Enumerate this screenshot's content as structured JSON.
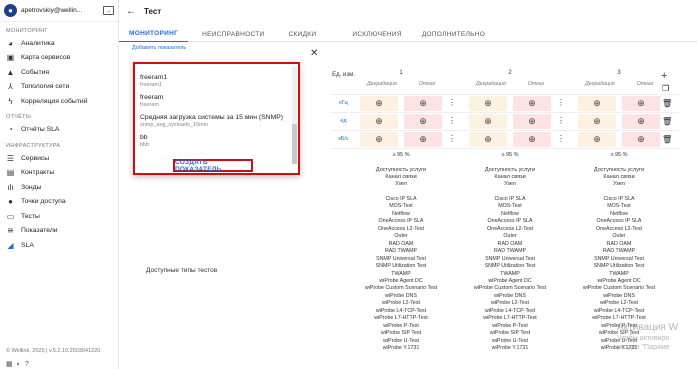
{
  "user": {
    "name": "apetrovskiy@wellin..."
  },
  "sidebar": {
    "sections": [
      {
        "title": "МОНИТОРИНГ",
        "items": [
          {
            "label": "Аналитика",
            "icon": "analytics-icon"
          },
          {
            "label": "Карта сервисов",
            "icon": "map-icon"
          },
          {
            "label": "События",
            "icon": "warning-icon"
          },
          {
            "label": "Топология сети",
            "icon": "topology-icon"
          },
          {
            "label": "Корреляция событий",
            "icon": "correlation-icon"
          }
        ]
      },
      {
        "title": "ОТЧЁТЫ",
        "items": [
          {
            "label": "Отчёты SLA",
            "icon": "report-icon"
          }
        ]
      },
      {
        "title": "ИНФРАСТРУКТУРА",
        "items": [
          {
            "label": "Сервисы",
            "icon": "list-icon"
          },
          {
            "label": "Контракты",
            "icon": "contract-icon"
          },
          {
            "label": "Зонды",
            "icon": "probe-icon"
          },
          {
            "label": "Точки доступа",
            "icon": "dot-icon"
          },
          {
            "label": "Тесты",
            "icon": "test-icon"
          },
          {
            "label": "Показатели",
            "icon": "metrics-icon"
          },
          {
            "label": "SLA",
            "icon": "sla-icon",
            "active": true
          }
        ]
      }
    ],
    "footer": "© Wellink, 2025 | v.5.2.10.2503041220"
  },
  "header": {
    "title": "Тест"
  },
  "tabs": [
    "МОНИТОРИНГ",
    "НЕИСПРАВНОСТИ",
    "СКИДКИ",
    "ИСКЛЮЧЕНИЯ",
    "ДОПОЛНИТЕЛЬНО"
  ],
  "add_indicator_label": "Добавить показатель",
  "dropdown": {
    "items": [
      {
        "title": "freeram1",
        "sub": "freeram1"
      },
      {
        "title": "freeram",
        "sub": "freeram"
      },
      {
        "title": "Средняя загрузка системы за 15 мин (SNMP)",
        "sub": "snmp_avg_sysloads_15min"
      },
      {
        "title": "bb",
        "sub": "bbb"
      }
    ],
    "create_label": "СОЗДАТЬ ПОКАЗАТЕЛЬ"
  },
  "table": {
    "unit_header": "Ед. изм.",
    "columns": [
      {
        "num": "1",
        "deg": "Деградация",
        "fail": "Отказ",
        "pct": "≥ 95 %"
      },
      {
        "num": "2",
        "deg": "Деградация",
        "fail": "Отказ",
        "pct": "≥ 95 %"
      },
      {
        "num": "3",
        "deg": "Деградация",
        "fail": "Отказ",
        "pct": "≥ 95 %"
      }
    ],
    "units": [
      "кГц",
      "ед",
      "кБ/с"
    ],
    "services": [
      "Доступность услуги",
      "Канал связи",
      "Узел"
    ],
    "tests_label": "Доступные типы тестов",
    "tests": [
      "Cisco IP SLA",
      "MOS-Test",
      "Netflow",
      "OneAccess IP SLA",
      "OneAccess L2-Test",
      "Outer",
      "RAD OAM",
      "RAD TWAMP",
      "SNMP Universal Test",
      "SNMP Utilization Test",
      "TWAMP",
      "wiProbe Agent DC",
      "wiProbe Custom Scenario Test",
      "wiProbe DNS",
      "wiProbe L2-Test",
      "wiProbe L4-TCP-Test",
      "wiProbe L7-HTTP-Test",
      "wiProbe P-Test",
      "wiProbe SIP Test",
      "wiProbe U-Test",
      "wiProbe Y.1731"
    ]
  },
  "watermark": {
    "line1": "Активация W",
    "line2": "Чтобы активиро",
    "line3": "раздел \"Параме"
  }
}
